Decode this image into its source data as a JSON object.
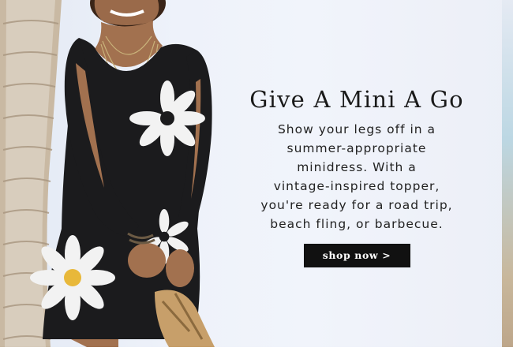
{
  "banner": {
    "headline": "Give A Mini A Go",
    "body_lines": [
      "Show your legs off in a",
      "summer-appropriate",
      "minidress. With a",
      "vintage-inspired topper,",
      "you're ready for a road trip,",
      "beach fling, or barbecue."
    ],
    "cta_label": "shop now >",
    "colors": {
      "background": "#eef2fa",
      "headline": "#1a1a1a",
      "button_bg": "#111111",
      "button_text": "#ffffff"
    }
  },
  "photo": {
    "subject": "model-in-black-daisy-print-minidress"
  }
}
